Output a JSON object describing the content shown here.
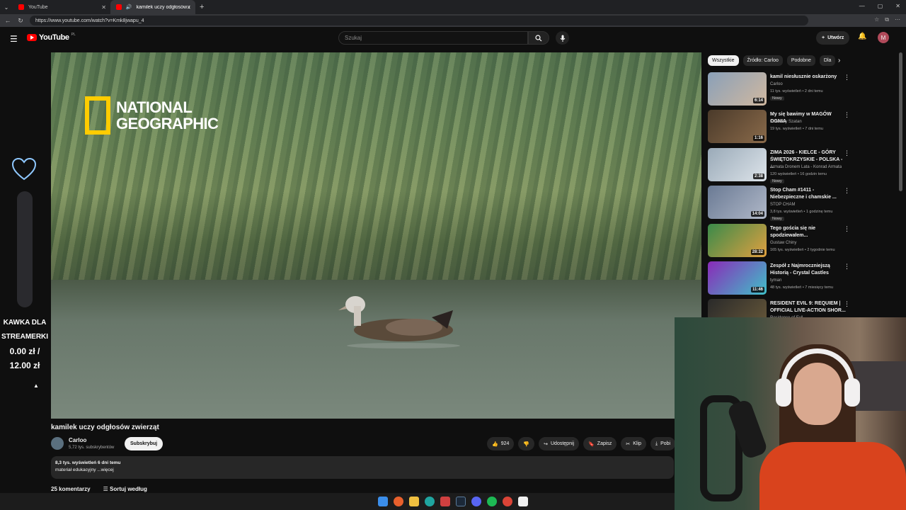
{
  "browser": {
    "tabs": [
      {
        "title": "YouTube"
      },
      {
        "title": "kamilek uczy odgłosów zwierz"
      }
    ],
    "url": "https://www.youtube.com/watch?v=Kmk8jwapu_4"
  },
  "masthead": {
    "logo_text": "YouTube",
    "logo_country": "PL",
    "search_placeholder": "Szukaj",
    "create_label": "Utwórz",
    "avatar_letter": "M"
  },
  "overlay": {
    "line1": "KAWKA DLA",
    "line2": "STREAMERKI",
    "amount1": "0.00 zł /",
    "amount2": "12.00 zł"
  },
  "video": {
    "watermark_line1": "NATIONAL",
    "watermark_line2": "GEOGRAPHIC",
    "title": "kamilek uczy odgłosów zwierząt",
    "channel": "Carloo",
    "subscribers": "5,72 tys. subskrybentów",
    "subscribe_label": "Subskrybuj",
    "likes": "924",
    "share_label": "Udostępnij",
    "save_label": "Zapisz",
    "clip_label": "Klip",
    "download_label": "Pobi",
    "desc_stats": "8,3 tys. wyświetleń  6 dni temu",
    "desc_text": "materiał edukacyjny ...więcej",
    "comments_count": "25 komentarzy",
    "sort_label": "Sortuj według"
  },
  "chips": [
    "Wszystkie",
    "Źródło: Carloo",
    "Podobne",
    "Dla"
  ],
  "recommendations": [
    {
      "title": "kamil niesłusznie oskarżony",
      "channel": "Carloo",
      "meta": "11 tys. wyświetleń • 2 dni temu",
      "badge": "Nowy",
      "duration": "6:14",
      "colors": [
        "#8aa0b8",
        "#d0b8a0"
      ]
    },
    {
      "title": "My się bawimy w MAGÓW OGNIA",
      "channel": "Kakaowy Szatan",
      "meta": "19 tys. wyświetleń • 7 dni temu",
      "badge": "",
      "duration": "1:16",
      "colors": [
        "#4a3a2a",
        "#8a6a4a"
      ]
    },
    {
      "title": "ZIMA 2026 - KIELCE - GÓRY ŚWIĘTOKRZYSKIE - POLSKA - ...",
      "channel": "Armata Dronem Lata - Konrad Armata",
      "meta": "120 wyświetleń • 16 godzin temu",
      "badge": "Nowy",
      "duration": "2:38",
      "colors": [
        "#9aaab8",
        "#dde4ea"
      ]
    },
    {
      "title": "Stop Cham #1411 - Niebezpieczne i chamskie ...",
      "channel": "STOP CHAM",
      "meta": "3,8 tys. wyświetleń • 1 godzinę temu",
      "badge": "Nowy",
      "duration": "14:04",
      "colors": [
        "#6a7a94",
        "#b0b8c8"
      ]
    },
    {
      "title": "Tego gościa się nie spodziewałem...",
      "channel": "Gustaw Chiny",
      "meta": "165 tys. wyświetleń • 2 tygodnie temu",
      "badge": "",
      "duration": "28:32",
      "colors": [
        "#3a8a4a",
        "#e0a040"
      ]
    },
    {
      "title": "Zespół z Najmroczniejszą Historią - Crystal Castles",
      "channel": "tyman",
      "meta": "48 tys. wyświetleń • 7 miesięcy temu",
      "badge": "",
      "duration": "11:46",
      "colors": [
        "#8a2ab8",
        "#40c0c8"
      ]
    },
    {
      "title": "RESIDENT EVIL 9: REQUIEM | OFFICIAL LIVE-ACTION SHOR...",
      "channel": "Residence of Evil",
      "meta": "",
      "badge": "",
      "duration": "",
      "colors": [
        "#2a2a2a",
        "#6a5a3a"
      ]
    }
  ]
}
